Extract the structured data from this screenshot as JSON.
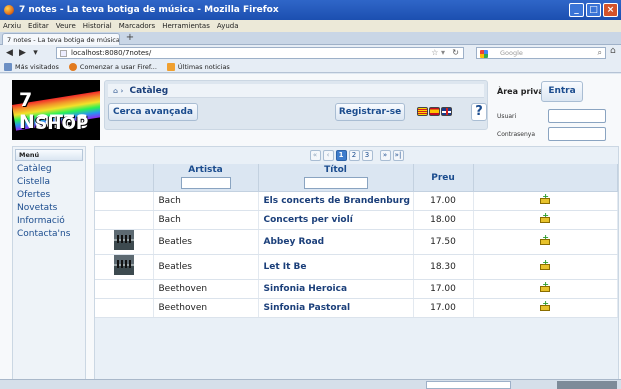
{
  "window": {
    "title": "7 notes - La teva botiga de música - Mozilla Firefox"
  },
  "menubar": [
    "Arxiu",
    "Editar",
    "Veure",
    "Historial",
    "Marcadors",
    "Herramientas",
    "Ayuda"
  ],
  "tab": {
    "label": "7 notes - La teva botiga de música",
    "new_tab": "+"
  },
  "nav": {
    "url": "localhost:8080/7notes/",
    "search_placeholder": "Google"
  },
  "bookmarks": [
    "Más visitados",
    "Comenzar a usar Firef...",
    "Últimas noticias"
  ],
  "logo": {
    "line1": "7 NOTES",
    "line2": "SHOP"
  },
  "breadcrumb": {
    "label": "Catàleg"
  },
  "buttons": {
    "advanced_search": "Cerca avançada",
    "register": "Registrar-se",
    "help": "?"
  },
  "private_area": {
    "title": "Àrea privada",
    "enter": "Entra",
    "user_label": "Usuari",
    "password_label": "Contrasenya"
  },
  "sidebar": {
    "heading": "Menú",
    "items": [
      "Catàleg",
      "Cistella",
      "Ofertes",
      "Novetats",
      "Informació",
      "Contacta'ns"
    ]
  },
  "pager": {
    "first": "«",
    "prev": "‹",
    "pages": [
      "1",
      "2",
      "3"
    ],
    "current": "1",
    "next": "»",
    "last": "»|"
  },
  "table": {
    "headers": {
      "artist": "Artista",
      "title": "Títol",
      "price": "Preu"
    },
    "rows": [
      {
        "artist": "Bach",
        "title": "Els concerts de Brandenburg",
        "price": "17.00",
        "image": false
      },
      {
        "artist": "Bach",
        "title": "Concerts per violí",
        "price": "18.00",
        "image": false
      },
      {
        "artist": "Beatles",
        "title": "Abbey Road",
        "price": "17.50",
        "image": true
      },
      {
        "artist": "Beatles",
        "title": "Let It Be",
        "price": "18.30",
        "image": true
      },
      {
        "artist": "Beethoven",
        "title": "Sinfonia Heroica",
        "price": "17.00",
        "image": false
      },
      {
        "artist": "Beethoven",
        "title": "Sinfonia Pastoral",
        "price": "17.00",
        "image": false
      }
    ]
  },
  "colors": {
    "title_bar": "#1c4fb0",
    "link_blue": "#1b4c8e",
    "pager_active": "#3f7dcc"
  }
}
